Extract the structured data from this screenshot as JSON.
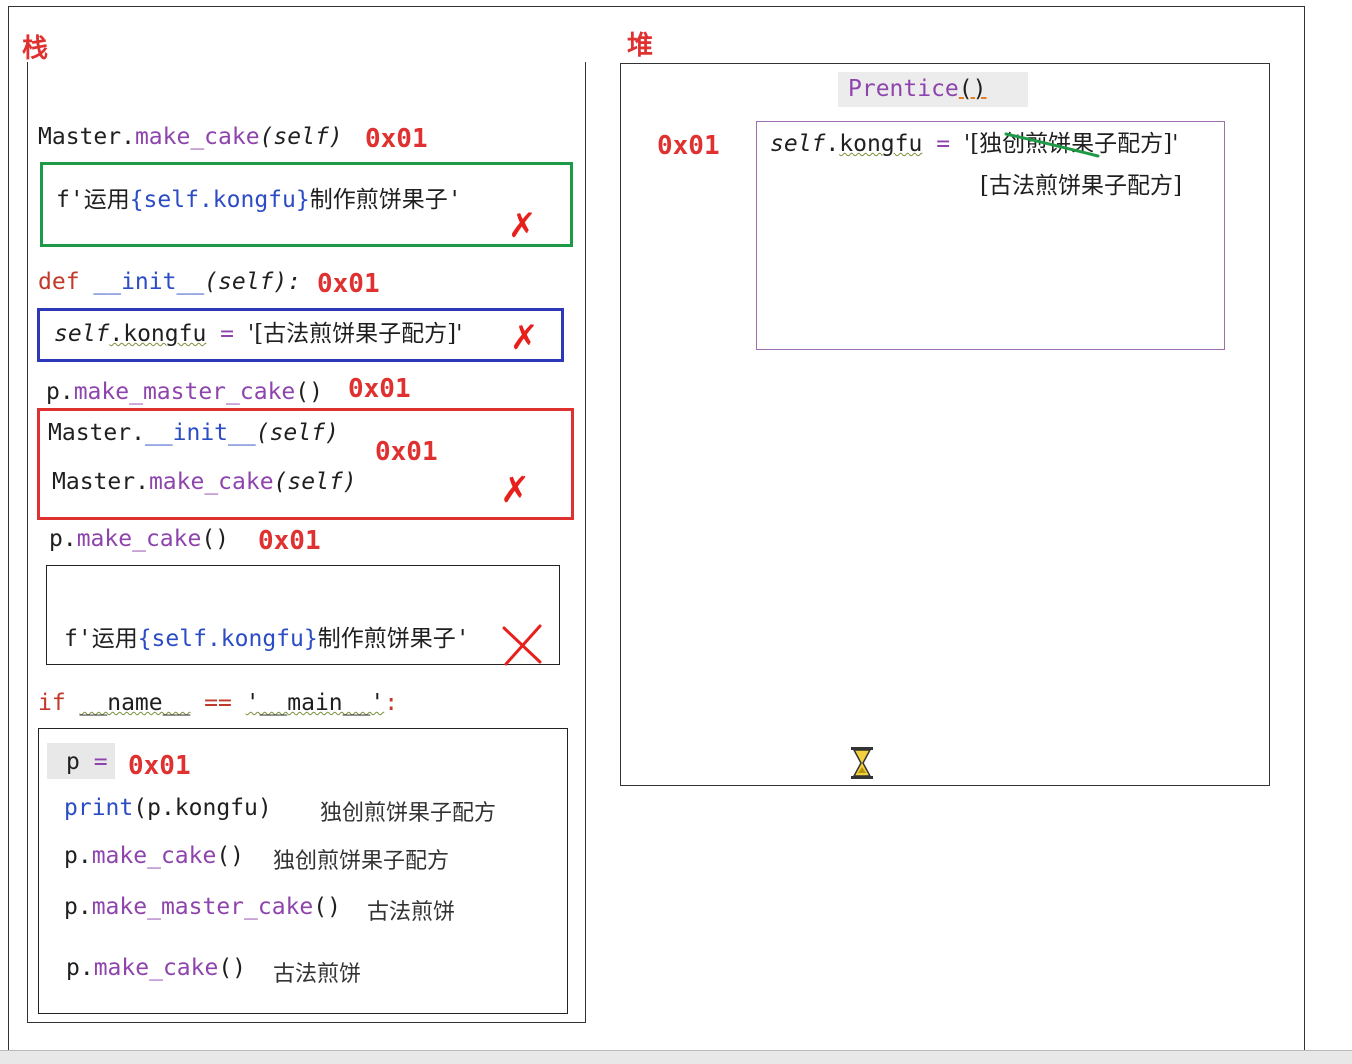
{
  "titles": {
    "stack": "栈",
    "heap": "堆"
  },
  "heap": {
    "object_label": "Prentice",
    "object_parens": "()",
    "address": "0x01",
    "attr_name_self": "self",
    "attr_name_dot": ".",
    "attr_name_kongfu": "kongfu",
    "attr_eq": " = ",
    "attr_old_value": "'[独创煎饼果子配方]'",
    "attr_new_value": "[古法煎饼果子配方]"
  },
  "stack": {
    "frame_master_make_cake": {
      "obj": "Master.",
      "method": "make_cake",
      "args": "(self)",
      "address": "0x01",
      "body_f": "f'",
      "body_text1": "运用",
      "body_expr": "{self.kongfu}",
      "body_text2": "制作煎饼果子",
      "body_end": "'"
    },
    "frame_init": {
      "kw": "def ",
      "name": "__init__",
      "args": "(self):",
      "address": "0x01",
      "body_self": "self",
      "body_rest": ".kongfu",
      "body_eq": " = ",
      "body_value": "'[古法煎饼果子配方]'"
    },
    "frame_make_master_cake": {
      "obj": "p.",
      "method": "make_master_cake",
      "args": "()",
      "address": "0x01",
      "line1_obj": "Master.",
      "line1_method": "__init__",
      "line1_args": "(self)",
      "line2_obj": "Master.",
      "line2_method": "make_cake",
      "line2_args": "(self)",
      "inner_address": "0x01"
    },
    "frame_make_cake": {
      "obj": "p.",
      "method": "make_cake",
      "args": "()",
      "address": "0x01",
      "body_f": "f'",
      "body_text1": "运用",
      "body_expr": "{self.kongfu}",
      "body_text2": "制作煎饼果子",
      "body_end": "'"
    },
    "main_guard": {
      "kw": "if ",
      "name": "__name__",
      "eq": " == ",
      "value": "'__main__'",
      "colon": ":"
    },
    "main_block": {
      "p_var": "p",
      "p_eq": " = ",
      "p_address": "0x01",
      "lines": [
        {
          "fn": "print",
          "args": "(p.kongfu)",
          "output": "独创煎饼果子配方"
        },
        {
          "obj": "p.",
          "method": "make_cake",
          "args": "()",
          "output": "独创煎饼果子配方"
        },
        {
          "obj": "p.",
          "method": "make_master_cake",
          "args": "()",
          "output": "古法煎饼"
        },
        {
          "obj": "p.",
          "method": "make_cake",
          "args": "()",
          "output": "古法煎饼"
        }
      ]
    }
  },
  "colors": {
    "annotation_red": "#e03131",
    "frame_green": "#1e9a46",
    "frame_blue": "#2d38b8",
    "object_border": "#9c6fb0",
    "method_purple": "#8e44ad"
  }
}
